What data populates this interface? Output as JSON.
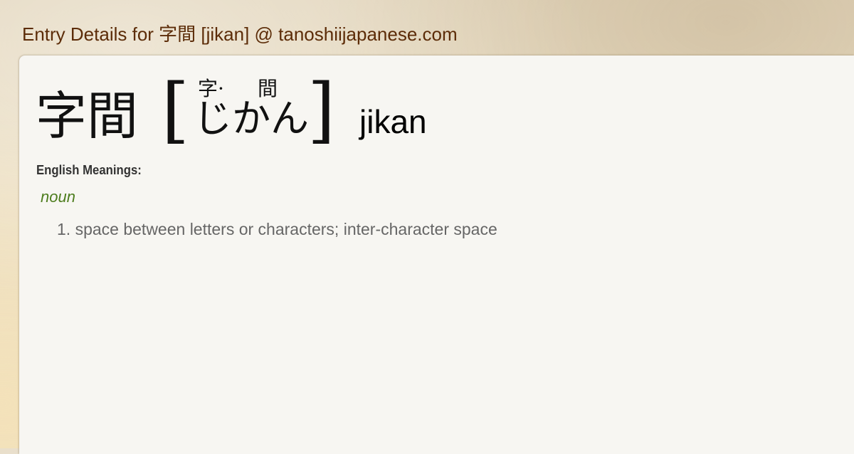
{
  "header": {
    "title": "Entry Details for 字間 [jikan] @ tanoshiijapanese.com"
  },
  "entry": {
    "headword": "字間",
    "bracket_open": "[",
    "bracket_close": "]",
    "furigana": [
      "字·",
      "間"
    ],
    "kana": "じかん",
    "romaji": "jikan"
  },
  "meanings": {
    "label": "English Meanings:",
    "part_of_speech": "noun",
    "items": [
      {
        "number": "1.",
        "text": "space between letters or characters; inter-character space"
      }
    ]
  },
  "colors": {
    "header_text": "#5c2c08",
    "part_of_speech": "#4d7d1e",
    "meaning_text": "#666666",
    "card_background": "#f7f6f2"
  }
}
